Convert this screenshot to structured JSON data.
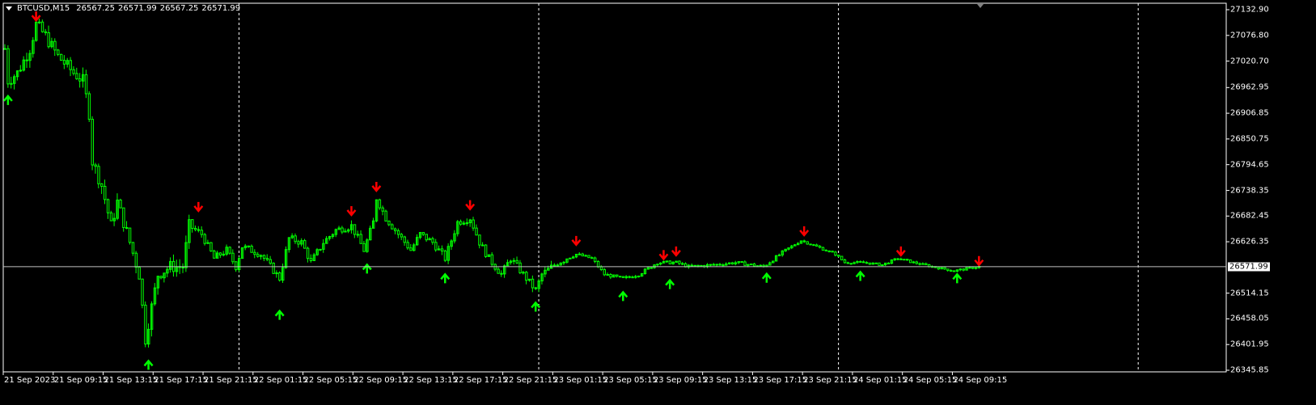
{
  "header": {
    "symbol": "BTCUSD,M15",
    "open": "26567.25",
    "high": "26571.99",
    "low": "26567.25",
    "close": "26571.99"
  },
  "current_price": "26571.99",
  "colors": {
    "bull": "#00ff00",
    "bear": "#00ff00",
    "up_arrow": "#00ff00",
    "down_arrow": "#ff0000",
    "grid": "#ffffff",
    "bid_line": "#c0c0c0"
  },
  "price_axis": [
    "27132.90",
    "27076.80",
    "27020.70",
    "26962.95",
    "26906.85",
    "26850.75",
    "26794.65",
    "26738.35",
    "26682.45",
    "26626.35",
    "26514.15",
    "26458.05",
    "26401.95",
    "26345.85"
  ],
  "time_axis": [
    "21 Sep 2023",
    "21 Sep 09:15",
    "21 Sep 13:15",
    "21 Sep 17:15",
    "21 Sep 21:15",
    "22 Sep 01:15",
    "22 Sep 05:15",
    "22 Sep 09:15",
    "22 Sep 13:15",
    "22 Sep 17:15",
    "22 Sep 21:15",
    "23 Sep 01:15",
    "23 Sep 05:15",
    "23 Sep 09:15",
    "23 Sep 13:15",
    "23 Sep 17:15",
    "23 Sep 21:15",
    "24 Sep 01:15",
    "24 Sep 05:15",
    "24 Sep 09:15"
  ],
  "chart_data": {
    "type": "candlestick",
    "symbol": "BTCUSD",
    "timeframe": "M15",
    "ylim": [
      26345.85,
      27132.9
    ],
    "bars_per_label": 16,
    "day_separator_bars": [
      75,
      171,
      267,
      363
    ],
    "price_path": [
      [
        0,
        27048
      ],
      [
        1,
        26978
      ],
      [
        4,
        26995
      ],
      [
        8,
        27048
      ],
      [
        10,
        27101
      ],
      [
        13,
        27075
      ],
      [
        17,
        27031
      ],
      [
        22,
        26995
      ],
      [
        25,
        26978
      ],
      [
        27,
        26907
      ],
      [
        28,
        26802
      ],
      [
        31,
        26749
      ],
      [
        34,
        26661
      ],
      [
        36,
        26713
      ],
      [
        40,
        26625
      ],
      [
        43,
        26555
      ],
      [
        45,
        26414
      ],
      [
        47,
        26484
      ],
      [
        49,
        26555
      ],
      [
        53,
        26572
      ],
      [
        57,
        26572
      ],
      [
        59,
        26661
      ],
      [
        63,
        26643
      ],
      [
        67,
        26590
      ],
      [
        71,
        26608
      ],
      [
        74,
        26572
      ],
      [
        76,
        26616
      ],
      [
        82,
        26599
      ],
      [
        88,
        26546
      ],
      [
        91,
        26634
      ],
      [
        95,
        26625
      ],
      [
        98,
        26581
      ],
      [
        102,
        26625
      ],
      [
        106,
        26652
      ],
      [
        111,
        26661
      ],
      [
        115,
        26608
      ],
      [
        118,
        26669
      ],
      [
        119,
        26722
      ],
      [
        122,
        26678
      ],
      [
        126,
        26643
      ],
      [
        130,
        26608
      ],
      [
        133,
        26643
      ],
      [
        137,
        26625
      ],
      [
        141,
        26590
      ],
      [
        145,
        26669
      ],
      [
        149,
        26678
      ],
      [
        152,
        26625
      ],
      [
        155,
        26590
      ],
      [
        159,
        26555
      ],
      [
        162,
        26590
      ],
      [
        166,
        26555
      ],
      [
        170,
        26520
      ],
      [
        172,
        26555
      ],
      [
        177,
        26581
      ],
      [
        183,
        26599
      ],
      [
        188,
        26590
      ],
      [
        192,
        26555
      ],
      [
        198,
        26546
      ],
      [
        203,
        26555
      ],
      [
        209,
        26581
      ],
      [
        215,
        26581
      ],
      [
        219,
        26572
      ],
      [
        227,
        26576
      ],
      [
        234,
        26581
      ],
      [
        243,
        26572
      ],
      [
        250,
        26608
      ],
      [
        255,
        26629
      ],
      [
        260,
        26616
      ],
      [
        266,
        26599
      ],
      [
        269,
        26581
      ],
      [
        275,
        26581
      ],
      [
        281,
        26576
      ],
      [
        286,
        26590
      ],
      [
        291,
        26581
      ],
      [
        297,
        26572
      ],
      [
        304,
        26563
      ],
      [
        312,
        26572
      ]
    ],
    "signals": [
      {
        "bar": 10,
        "price": 27115,
        "dir": "down"
      },
      {
        "bar": 62,
        "price": 26699,
        "dir": "down"
      },
      {
        "bar": 111,
        "price": 26690,
        "dir": "down"
      },
      {
        "bar": 119,
        "price": 26743,
        "dir": "down"
      },
      {
        "bar": 149,
        "price": 26703,
        "dir": "down"
      },
      {
        "bar": 183,
        "price": 26625,
        "dir": "down"
      },
      {
        "bar": 211,
        "price": 26594,
        "dir": "down"
      },
      {
        "bar": 215,
        "price": 26602,
        "dir": "down"
      },
      {
        "bar": 256,
        "price": 26646,
        "dir": "down"
      },
      {
        "bar": 287,
        "price": 26602,
        "dir": "down"
      },
      {
        "bar": 312,
        "price": 26581,
        "dir": "down"
      },
      {
        "bar": 1,
        "price": 26939,
        "dir": "up"
      },
      {
        "bar": 46,
        "price": 26361,
        "dir": "up"
      },
      {
        "bar": 88,
        "price": 26470,
        "dir": "up"
      },
      {
        "bar": 116,
        "price": 26571,
        "dir": "up"
      },
      {
        "bar": 141,
        "price": 26550,
        "dir": "up"
      },
      {
        "bar": 170,
        "price": 26488,
        "dir": "up"
      },
      {
        "bar": 198,
        "price": 26511,
        "dir": "up"
      },
      {
        "bar": 213,
        "price": 26537,
        "dir": "up"
      },
      {
        "bar": 244,
        "price": 26551,
        "dir": "up"
      },
      {
        "bar": 274,
        "price": 26555,
        "dir": "up"
      },
      {
        "bar": 305,
        "price": 26550,
        "dir": "up"
      }
    ]
  }
}
